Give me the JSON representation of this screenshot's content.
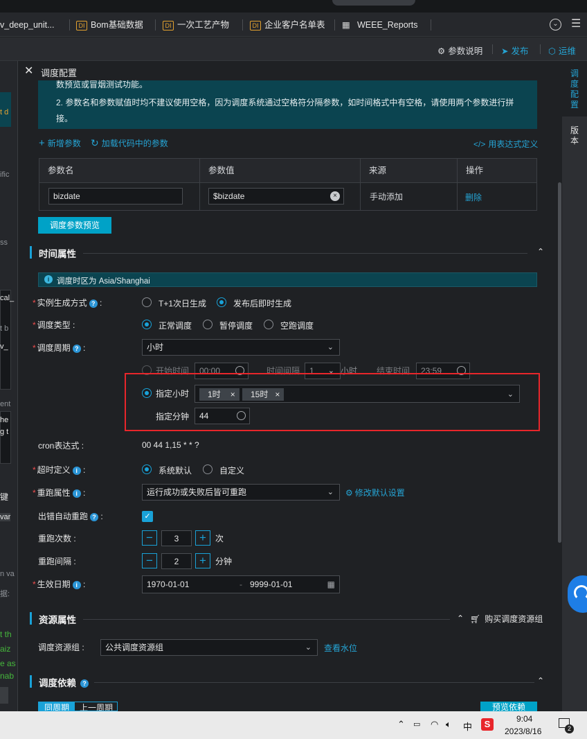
{
  "top_tabs": [
    {
      "label": "v_deep_unit...",
      "icon": "none"
    },
    {
      "label": "Bom基础数据",
      "icon": "di-icon"
    },
    {
      "label": "一次工艺产物",
      "icon": "di-icon"
    },
    {
      "label": "企业客户名单表",
      "icon": "di-icon"
    },
    {
      "label": "WEEE_Reports",
      "icon": "table-icon"
    }
  ],
  "top_tab_di": "DI",
  "action_bar": {
    "param_doc": "参数说明",
    "publish": "发布",
    "ops": "运维"
  },
  "right_rail": {
    "schedule": "调度配置",
    "version": "版本"
  },
  "left_pane_fragments": [
    "t d",
    "ific",
    "ss",
    "cal_",
    "t b",
    "v_",
    "ent",
    "he",
    "g t",
    "键",
    "var",
    "n va",
    "据:",
    "t th",
    "aiz",
    "e as",
    "nab"
  ],
  "panel": {
    "title": "调度配置",
    "notice_line1": "数预览或冒烟测试功能。",
    "notice_line2": "2. 参数名和参数赋值时均不建议使用空格，因为调度系统通过空格符分隔参数，如时间格式中有空格，请使用两个参数进行拼",
    "notice_line3": "接。",
    "add_param": "新增参数",
    "load_params": "加载代码中的参数",
    "expr_define": "用表达式定义",
    "table": {
      "headers": [
        "参数名",
        "参数值",
        "来源",
        "操作"
      ],
      "rows": [
        {
          "name": "bizdate",
          "value": "$bizdate",
          "source": "手动添加",
          "action": "删除"
        }
      ]
    },
    "preview_btn": "调度参数预览"
  },
  "time_props": {
    "title": "时间属性",
    "timezone": "调度时区为 Asia/Shanghai",
    "instance_gen_label": "实例生成方式",
    "instance_gen_opt1": "T+1次日生成",
    "instance_gen_opt2": "发布后即时生成",
    "instance_gen_selected": 2,
    "sched_type_label": "调度类型",
    "sched_type_opt1": "正常调度",
    "sched_type_opt2": "暂停调度",
    "sched_type_opt3": "空跑调度",
    "sched_type_selected": 1,
    "cycle_label": "调度周期",
    "cycle_value": "小时",
    "start_time_label": "开始时间",
    "start_time": "00:00",
    "interval_label": "时间间隔",
    "interval_value": "1",
    "interval_unit": "小时",
    "end_time_label": "结束时间",
    "end_time": "23:59",
    "specify_hours_label": "指定小时",
    "hour_tags": [
      "1时",
      "15时"
    ],
    "specify_minute_label": "指定分钟",
    "minute_value": "44",
    "cron_label": "cron表达式",
    "cron_value": "00 44 1,15 * * ?",
    "timeout_label": "超时定义",
    "timeout_opt1": "系统默认",
    "timeout_opt2": "自定义",
    "rerun_label": "重跑属性",
    "rerun_value": "运行成功或失败后皆可重跑",
    "modify_default": "修改默认设置",
    "auto_rerun_label": "出错自动重跑",
    "auto_rerun_checked": true,
    "rerun_count_label": "重跑次数",
    "rerun_count": "3",
    "rerun_count_unit": "次",
    "rerun_interval_label": "重跑间隔",
    "rerun_interval": "2",
    "rerun_interval_unit": "分钟",
    "effective_label": "生效日期",
    "effective_start": "1970-01-01",
    "effective_sep": "-",
    "effective_end": "9999-01-01"
  },
  "resource_props": {
    "title": "资源属性",
    "buy_group": "购买调度资源组",
    "group_label": "调度资源组",
    "group_value": "公共调度资源组",
    "view_watermark": "查看水位"
  },
  "dependency": {
    "title": "调度依赖",
    "tab_same": "同周期",
    "tab_prev": "上一周期",
    "preview_dep": "预览依赖"
  },
  "taskbar": {
    "ime": "中",
    "time": "9:04",
    "date": "2023/8/16",
    "notif_count": "2"
  },
  "colors": {
    "accent": "#00a2c7",
    "notice_bg": "#0b4450",
    "highlight": "#e8262b",
    "required": "#ef4d4d"
  }
}
